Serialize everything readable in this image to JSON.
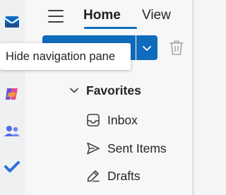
{
  "header": {
    "tabs": [
      {
        "label": "Home",
        "selected": true
      },
      {
        "label": "View",
        "selected": false
      }
    ]
  },
  "tooltip": {
    "text": "Hide navigation pane"
  },
  "left_rail": {
    "icons": [
      "outlook-mail-icon",
      "copilot-icon",
      "people-icon",
      "to-do-icon"
    ]
  },
  "favorites": {
    "header": "Favorites",
    "folders": [
      {
        "label": "Inbox",
        "icon": "inbox-icon"
      },
      {
        "label": "Sent Items",
        "icon": "send-icon"
      },
      {
        "label": "Drafts",
        "icon": "drafts-pencil-icon"
      }
    ]
  },
  "colors": {
    "accent": "#0f6cbd",
    "rail_background": "#eef0f2",
    "pane_background": "#f7f7f7",
    "text": "#242424"
  }
}
